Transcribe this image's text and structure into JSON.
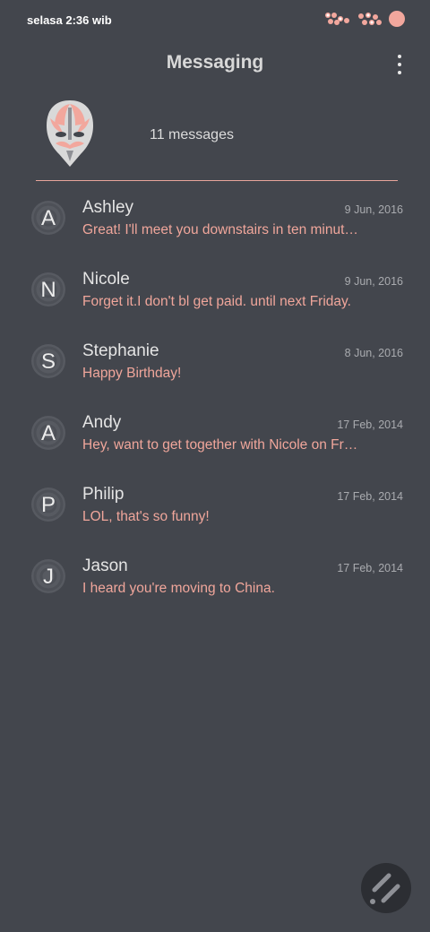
{
  "status_bar": {
    "time": "selasa 2:36 wib"
  },
  "app_bar": {
    "title": "Messaging"
  },
  "header": {
    "message_count": "11 messages"
  },
  "colors": {
    "background": "#43464d",
    "accent": "#f0a69b",
    "fab": "#2c2e33"
  },
  "conversations": [
    {
      "initial": "A",
      "name": "Ashley",
      "date": "9 Jun, 2016",
      "snippet": "Great! I'll meet you downstairs in ten minutes."
    },
    {
      "initial": "N",
      "name": "Nicole",
      "date": "9 Jun, 2016",
      "snippet": "Forget it.I don't bl get paid. until next Friday."
    },
    {
      "initial": "S",
      "name": "Stephanie",
      "date": "8 Jun, 2016",
      "snippet": "Happy Birthday!"
    },
    {
      "initial": "A",
      "name": "Andy",
      "date": "17 Feb, 2014",
      "snippet": "Hey, want to get together with Nicole on Friday?"
    },
    {
      "initial": "P",
      "name": "Philip",
      "date": "17 Feb, 2014",
      "snippet": "LOL, that's so funny!"
    },
    {
      "initial": "J",
      "name": "Jason",
      "date": "17 Feb, 2014",
      "snippet": "I heard you're moving to China."
    }
  ]
}
